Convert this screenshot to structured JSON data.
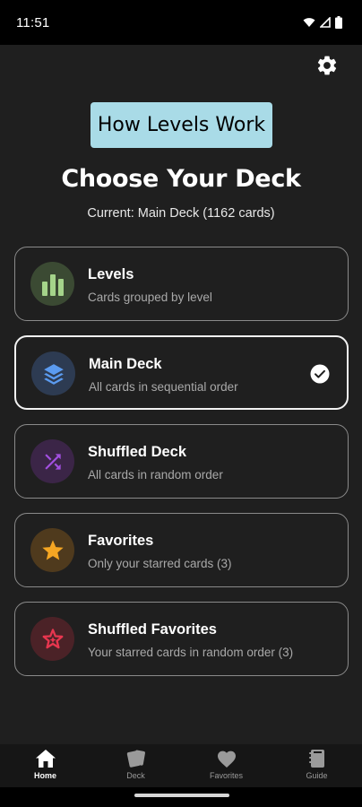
{
  "status_bar": {
    "time": "11:51",
    "icons": [
      "wifi-icon",
      "signal-icon",
      "battery-icon"
    ]
  },
  "header": {
    "settings_icon": "gear-icon",
    "levels_info_label": "How Levels Work",
    "title": "Choose Your Deck",
    "current": "Current: Main Deck (1162 cards)"
  },
  "decks": [
    {
      "name": "Levels",
      "description": "Cards grouped by level",
      "icon": "bar-chart-icon",
      "icon_color": "#a5d48a",
      "icon_bg": "#3b4a33",
      "selected": false
    },
    {
      "name": "Main Deck",
      "description": "All cards in sequential order",
      "icon": "layers-icon",
      "icon_color": "#5b9bf0",
      "icon_bg": "#2d3b52",
      "selected": true
    },
    {
      "name": "Shuffled Deck",
      "description": "All cards in random order",
      "icon": "shuffle-icon",
      "icon_color": "#a24fe0",
      "icon_bg": "#3b2547",
      "selected": false
    },
    {
      "name": "Favorites",
      "description": "Only your starred cards (3)",
      "icon": "star-icon",
      "icon_color": "#f5a623",
      "icon_bg": "#4f3a1d",
      "selected": false
    },
    {
      "name": "Shuffled Favorites",
      "description": "Your starred cards in random order (3)",
      "icon": "sparkle-star-icon",
      "icon_color": "#e8364f",
      "icon_bg": "#4b2227",
      "selected": false
    }
  ],
  "bottom_nav": [
    {
      "label": "Home",
      "icon": "home-icon",
      "active": true
    },
    {
      "label": "Deck",
      "icon": "cards-icon",
      "active": false
    },
    {
      "label": "Favorites",
      "icon": "heart-icon",
      "active": false
    },
    {
      "label": "Guide",
      "icon": "book-icon",
      "active": false
    }
  ],
  "colors": {
    "background": "#1f1f1f",
    "button_bg": "#a9dbe7",
    "card_border": "#8a8a8a",
    "selected_border": "#f2f2f2"
  }
}
